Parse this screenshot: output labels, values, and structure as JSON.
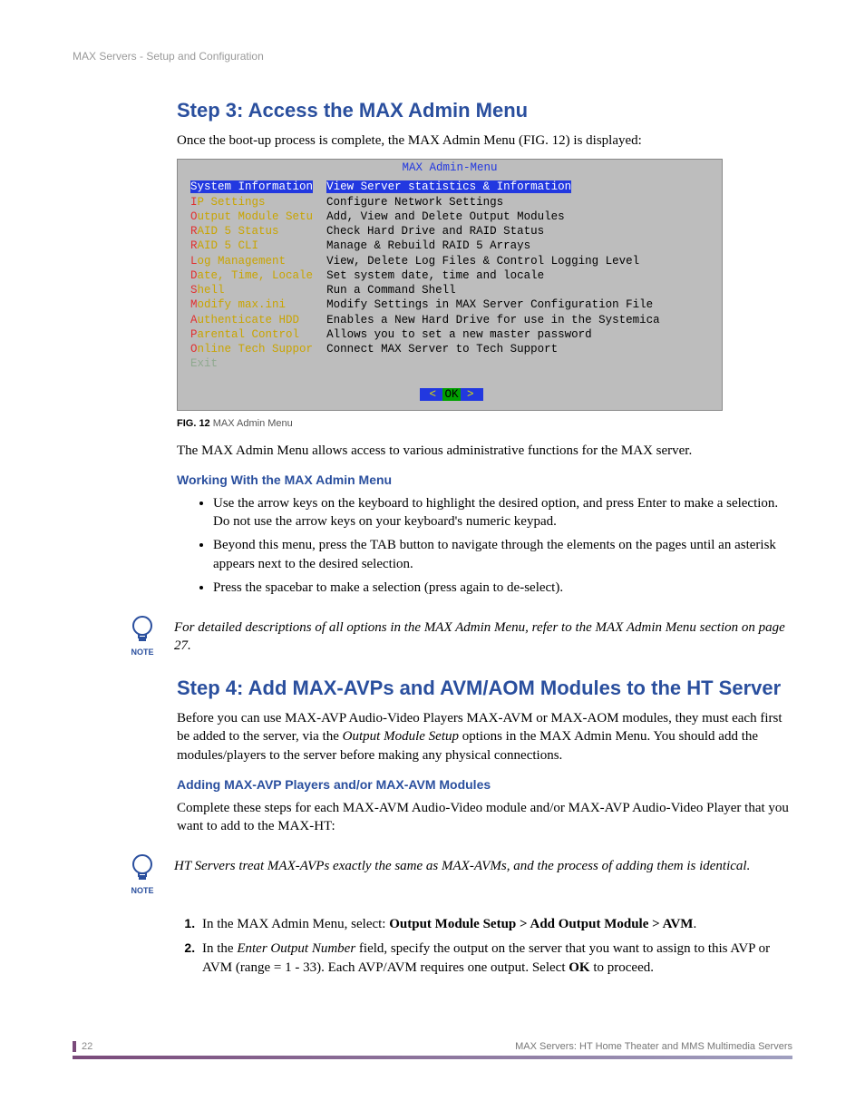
{
  "header": {
    "running": "MAX Servers - Setup and Configuration"
  },
  "step3": {
    "title": "Step 3: Access the MAX Admin Menu",
    "intro": "Once the boot-up process is complete, the MAX Admin Menu (FIG. 12) is displayed:",
    "figlabel": "FIG. 12",
    "figtext": "MAX Admin Menu",
    "after_fig": "The MAX Admin Menu allows access to various administrative functions for the MAX server.",
    "sub": "Working With the MAX Admin Menu",
    "bullets": [
      "Use the arrow keys on the keyboard to highlight the desired option, and press Enter to make a selection. Do not use the arrow keys on your keyboard's numeric keypad.",
      "Beyond this menu, press the TAB button to navigate through the elements on the pages until an asterisk appears next to the desired selection.",
      "Press the spacebar to make a selection (press again to de-select)."
    ],
    "note": "For detailed descriptions of all options in the MAX Admin Menu, refer to the MAX Admin Menu section on page 27."
  },
  "terminal": {
    "title": "MAX Admin-Menu",
    "rows": [
      {
        "hk": "S",
        "rest": "ystem Information",
        "desc": "View Server statistics & Information",
        "selected": true
      },
      {
        "hk": "I",
        "rest": "P Settings",
        "desc": "Configure Network Settings"
      },
      {
        "hk": "O",
        "rest": "utput Module Setu",
        "desc": "Add, View and Delete Output Modules"
      },
      {
        "hk": "R",
        "rest": "AID 5 Status",
        "desc": "Check Hard Drive and RAID Status"
      },
      {
        "hk": "R",
        "rest": "AID 5 CLI",
        "desc": "Manage & Rebuild RAID 5 Arrays"
      },
      {
        "hk": "L",
        "rest": "og Management",
        "desc": "View, Delete Log Files & Control Logging Level"
      },
      {
        "hk": "D",
        "rest": "ate, Time, Locale",
        "desc": "Set system date, time and locale"
      },
      {
        "hk": "S",
        "rest": "hell",
        "desc": "Run a Command Shell"
      },
      {
        "hk": "M",
        "rest": "odify max.ini",
        "desc": "Modify Settings in MAX Server Configuration File"
      },
      {
        "hk": "A",
        "rest": "uthenticate HDD",
        "desc": "Enables a New Hard Drive for use in the Systemica"
      },
      {
        "hk": "P",
        "rest": "arental Control",
        "desc": "Allows you to set a new master password"
      },
      {
        "hk": "O",
        "rest": "nline Tech Suppor",
        "desc": "Connect MAX Server to Tech Support"
      }
    ],
    "exit": "Exit",
    "ok_left": "<",
    "ok_mid": "OK",
    "ok_right": ">"
  },
  "step4": {
    "title": "Step 4: Add MAX-AVPs and AVM/AOM Modules to the HT Server",
    "p1a": "Before you can use MAX-AVP Audio-Video Players MAX-AVM or MAX-AOM modules, they must each first be added to the server, via the ",
    "p1i": "Output Module Setup",
    "p1b": " options in the MAX Admin Menu. You should add the modules/players to the server before making any physical connections.",
    "sub": "Adding MAX-AVP Players and/or MAX-AVM Modules",
    "p2": "Complete these steps for each MAX-AVM Audio-Video module and/or MAX-AVP Audio-Video Player that you want to add to the MAX-HT:",
    "note": "HT Servers treat MAX-AVPs exactly the same as MAX-AVMs, and the process of adding them is identical.",
    "ol": [
      {
        "a": "In the MAX Admin Menu, select: ",
        "b": "Output Module Setup > Add Output Module > AVM",
        "c": "."
      },
      {
        "a": "In the ",
        "i": "Enter Output Number",
        "b": " field, specify the output on the server that you want to assign to this AVP or AVM (range = 1 - 33). Each AVP/AVM requires one output. Select ",
        "ok": "OK",
        "c": " to proceed."
      }
    ]
  },
  "note_label": "NOTE",
  "footer": {
    "page": "22",
    "doc": "MAX Servers: HT Home Theater and MMS Multimedia Servers"
  }
}
